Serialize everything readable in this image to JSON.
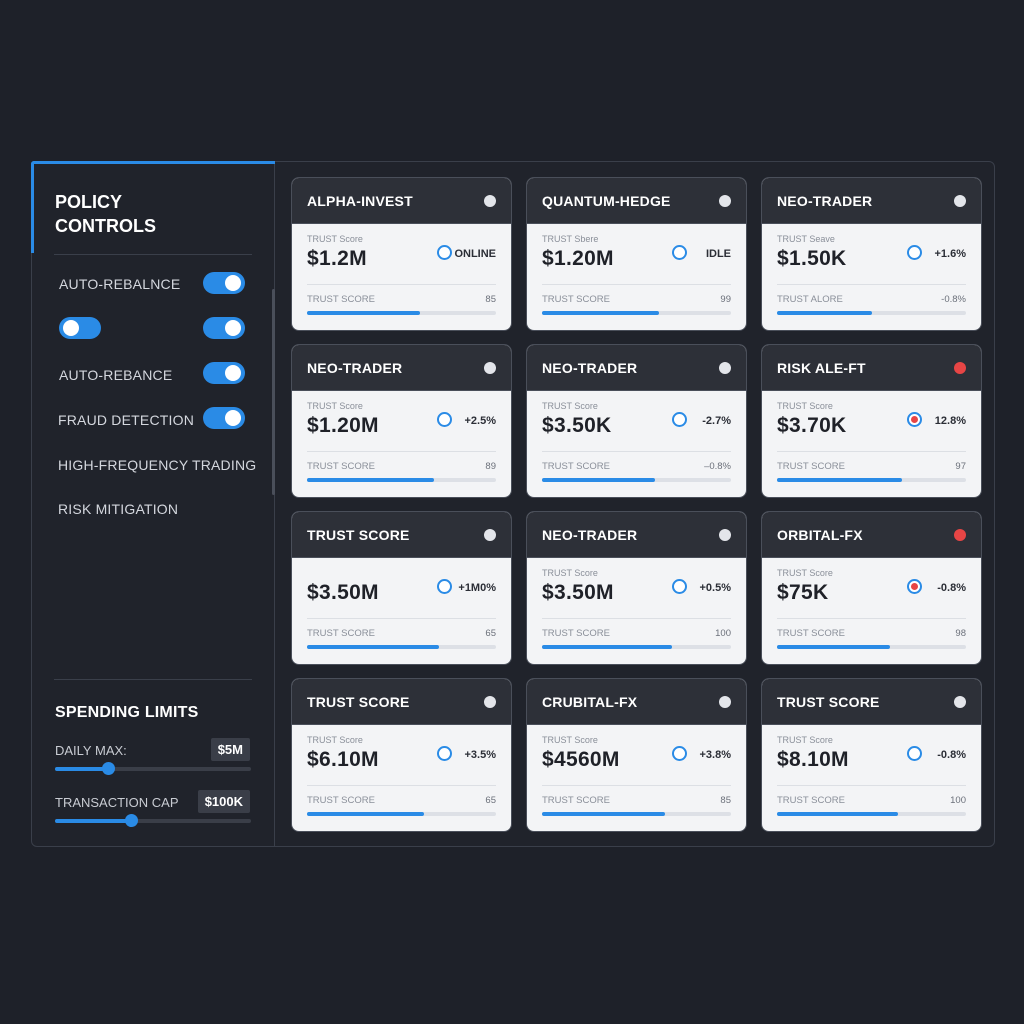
{
  "colors": {
    "accent": "#2a8be6",
    "alert": "#e74545",
    "background": "#1e2129",
    "card_header": "#2d3038",
    "card_body": "#f3f4f6"
  },
  "sidebar": {
    "title": "POLICY\nCONTROLS",
    "toggles": [
      {
        "label": "AUTO-REBALNCE",
        "state": "on"
      },
      {
        "label": "",
        "state": "off",
        "extra_toggle_state": "on"
      },
      {
        "label": "AUTO-REBANCE",
        "state": "on"
      },
      {
        "label": "FRAUD DETECTION",
        "state": "on"
      }
    ],
    "items": [
      {
        "label": "HIGH-FREQUENCY TRADING"
      },
      {
        "label": "RISK MITIGATION"
      }
    ],
    "spending_limits": {
      "title": "SPENDING LIMITS",
      "daily_max": {
        "label": "DAILY MAX:",
        "value": "$5M",
        "fill_fraction": 0.27
      },
      "transaction_cap": {
        "label": "TRANSACTION CAP",
        "value": "$100K",
        "fill_fraction": 0.39
      }
    }
  },
  "cards": [
    {
      "name": "ALPHA-INVEST",
      "status_dot": "normal",
      "metric_label": "TRUST Score",
      "metric_value": "$1.2M",
      "ring": "normal",
      "status_text": "ONLINE",
      "score_label": "TRUST SCORE",
      "score_value": "85",
      "score_fraction": 0.6
    },
    {
      "name": "QUANTUM-HEDGE",
      "status_dot": "normal",
      "metric_label": "TRUST Sbere",
      "metric_value": "$1.20M",
      "ring": "normal",
      "status_text": "IDLE",
      "score_label": "TRUST SCORE",
      "score_value": "99",
      "score_fraction": 0.62
    },
    {
      "name": "NEO-TRADER",
      "status_dot": "normal",
      "metric_label": "TRUST Seave",
      "metric_value": "$1.50K",
      "ring": "normal",
      "status_text": "+1.6%",
      "score_label": "TRUST ALORE",
      "score_value": "-0.8%",
      "score_fraction": 0.5
    },
    {
      "name": "NEO-TRADER",
      "status_dot": "normal",
      "metric_label": "TRUST Score",
      "metric_value": "$1.20M",
      "ring": "normal",
      "status_text": "+2.5%",
      "score_label": "TRUST SCORE",
      "score_value": "89",
      "score_fraction": 0.67
    },
    {
      "name": "NEO-TRADER",
      "status_dot": "normal",
      "metric_label": "TRUST Score",
      "metric_value": "$3.50K",
      "ring": "normal",
      "status_text": "-2.7%",
      "score_label": "TRUST SCORE",
      "score_value": "–0.8%",
      "score_fraction": 0.6
    },
    {
      "name": "RISK ALE-FT",
      "status_dot": "alert",
      "metric_label": "TRUST Score",
      "metric_value": "$3.70K",
      "ring": "alert",
      "status_text": "12.8%",
      "score_label": "TRUST SCORE",
      "score_value": "97",
      "score_fraction": 0.66
    },
    {
      "name": "TRUST SCORE",
      "status_dot": "normal",
      "metric_label": "",
      "metric_value": "$3.50M",
      "ring": "normal",
      "status_text": "+1M0%",
      "score_label": "TRUST SCORE",
      "score_value": "65",
      "score_fraction": 0.7
    },
    {
      "name": "NEO-TRADER",
      "status_dot": "normal",
      "metric_label": "TRUST Score",
      "metric_value": "$3.50M",
      "ring": "normal",
      "status_text": "+0.5%",
      "score_label": "TRUST SCORE",
      "score_value": "100",
      "score_fraction": 0.69
    },
    {
      "name": "ORBITAL-FX",
      "status_dot": "alert",
      "metric_label": "TRUST Score",
      "metric_value": "$75K",
      "ring": "alert",
      "status_text": "-0.8%",
      "score_label": "TRUST SCORE",
      "score_value": "98",
      "score_fraction": 0.6
    },
    {
      "name": "TRUST SCORE",
      "status_dot": "normal",
      "metric_label": "TRUST Score",
      "metric_value": "$6.10M",
      "ring": "normal",
      "status_text": "+3.5%",
      "score_label": "TRUST SCORE",
      "score_value": "65",
      "score_fraction": 0.62
    },
    {
      "name": "CRUBITAL-FX",
      "status_dot": "normal",
      "metric_label": "TRUST Score",
      "metric_value": "$4560M",
      "ring": "normal",
      "status_text": "+3.8%",
      "score_label": "TRUST SCORE",
      "score_value": "85",
      "score_fraction": 0.65
    },
    {
      "name": "TRUST SCORE",
      "status_dot": "normal",
      "metric_label": "TRUST Score",
      "metric_value": "$8.10M",
      "ring": "normal",
      "status_text": "-0.8%",
      "score_label": "TRUST SCORE",
      "score_value": "100",
      "score_fraction": 0.64
    }
  ]
}
